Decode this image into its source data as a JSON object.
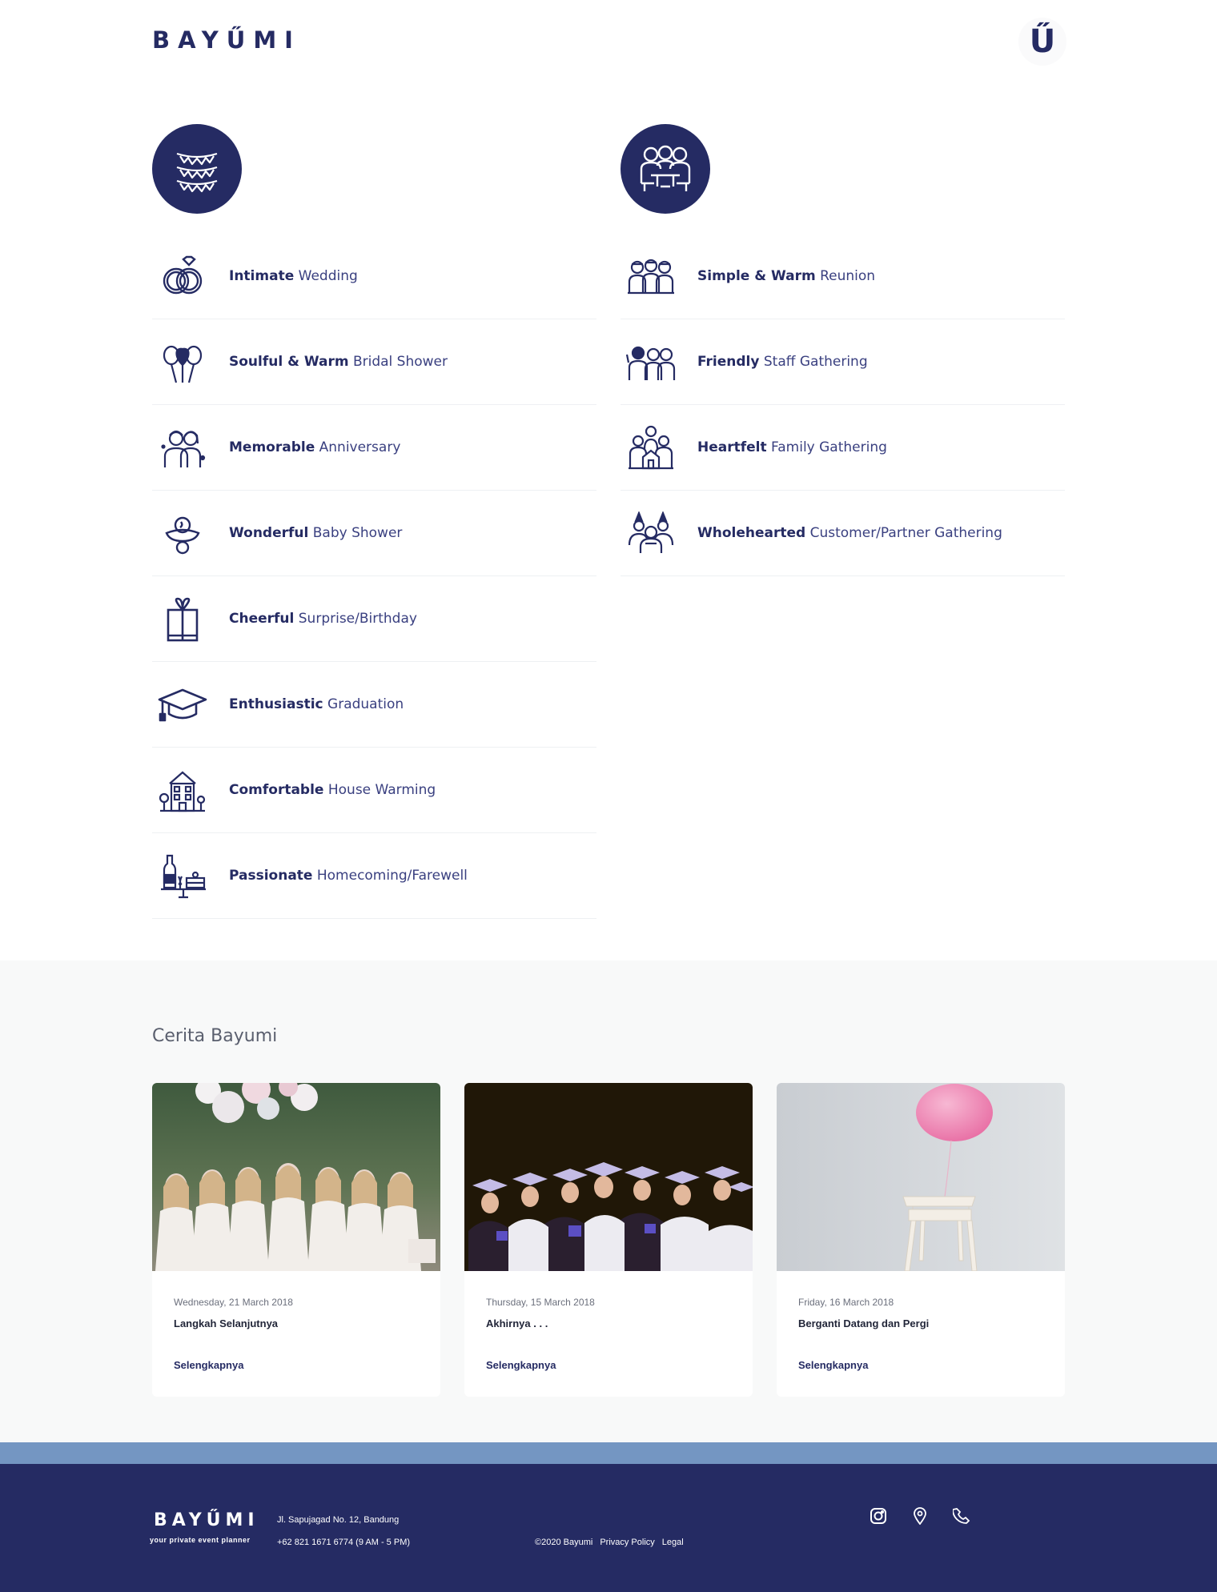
{
  "brand": {
    "name": "BAYŰMI",
    "menu_glyph": "Ű",
    "tagline": "your private event planner"
  },
  "categories": {
    "left": {
      "icon": "bunting-flags-icon",
      "items": [
        {
          "strong": "Intimate",
          "rest": "Wedding",
          "icon": "wedding-rings-icon"
        },
        {
          "strong": "Soulful & Warm",
          "rest": "Bridal Shower",
          "icon": "balloons-icon"
        },
        {
          "strong": "Memorable",
          "rest": "Anniversary",
          "icon": "couple-icon"
        },
        {
          "strong": "Wonderful",
          "rest": "Baby Shower",
          "icon": "pacifier-icon"
        },
        {
          "strong": "Cheerful",
          "rest": "Surprise/Birthday",
          "icon": "gift-icon"
        },
        {
          "strong": "Enthusiastic",
          "rest": "Graduation",
          "icon": "graduation-cap-icon"
        },
        {
          "strong": "Comfortable",
          "rest": "House Warming",
          "icon": "house-icon"
        },
        {
          "strong": "Passionate",
          "rest": "Homecoming/Farewell",
          "icon": "bottle-cake-icon"
        }
      ]
    },
    "right": {
      "icon": "people-at-table-icon",
      "items": [
        {
          "strong": "Simple & Warm",
          "rest": "Reunion",
          "icon": "group-reunion-icon"
        },
        {
          "strong": "Friendly",
          "rest": "Staff Gathering",
          "icon": "staff-group-icon"
        },
        {
          "strong": "Heartfelt",
          "rest": "Family Gathering",
          "icon": "family-icon"
        },
        {
          "strong": "Wholehearted",
          "rest": "Customer/Partner Gathering",
          "icon": "party-people-icon"
        }
      ]
    }
  },
  "stories": {
    "title": "Cerita Bayumi",
    "cards": [
      {
        "date": "Wednesday, 21 March 2018",
        "title": "Langkah Selanjutnya",
        "link": "Selengkapnya"
      },
      {
        "date": "Thursday, 15 March 2018",
        "title": "Akhirnya . . .",
        "link": "Selengkapnya"
      },
      {
        "date": "Friday, 16 March 2018",
        "title": "Berganti Datang dan Pergi",
        "link": "Selengkapnya"
      }
    ]
  },
  "footer": {
    "address": "Jl. Sapujagad No. 12, Bandung",
    "phone": "+62 821 1671 6774 (9 AM - 5 PM)",
    "copyright": "©2020 Bayumi",
    "privacy": "Privacy Policy",
    "legal": "Legal",
    "icons": [
      "instagram-icon",
      "map-pin-icon",
      "phone-icon"
    ]
  },
  "colors": {
    "navy": "#252b63",
    "strip": "#7496c2",
    "section_bg": "#f8f9f9"
  }
}
